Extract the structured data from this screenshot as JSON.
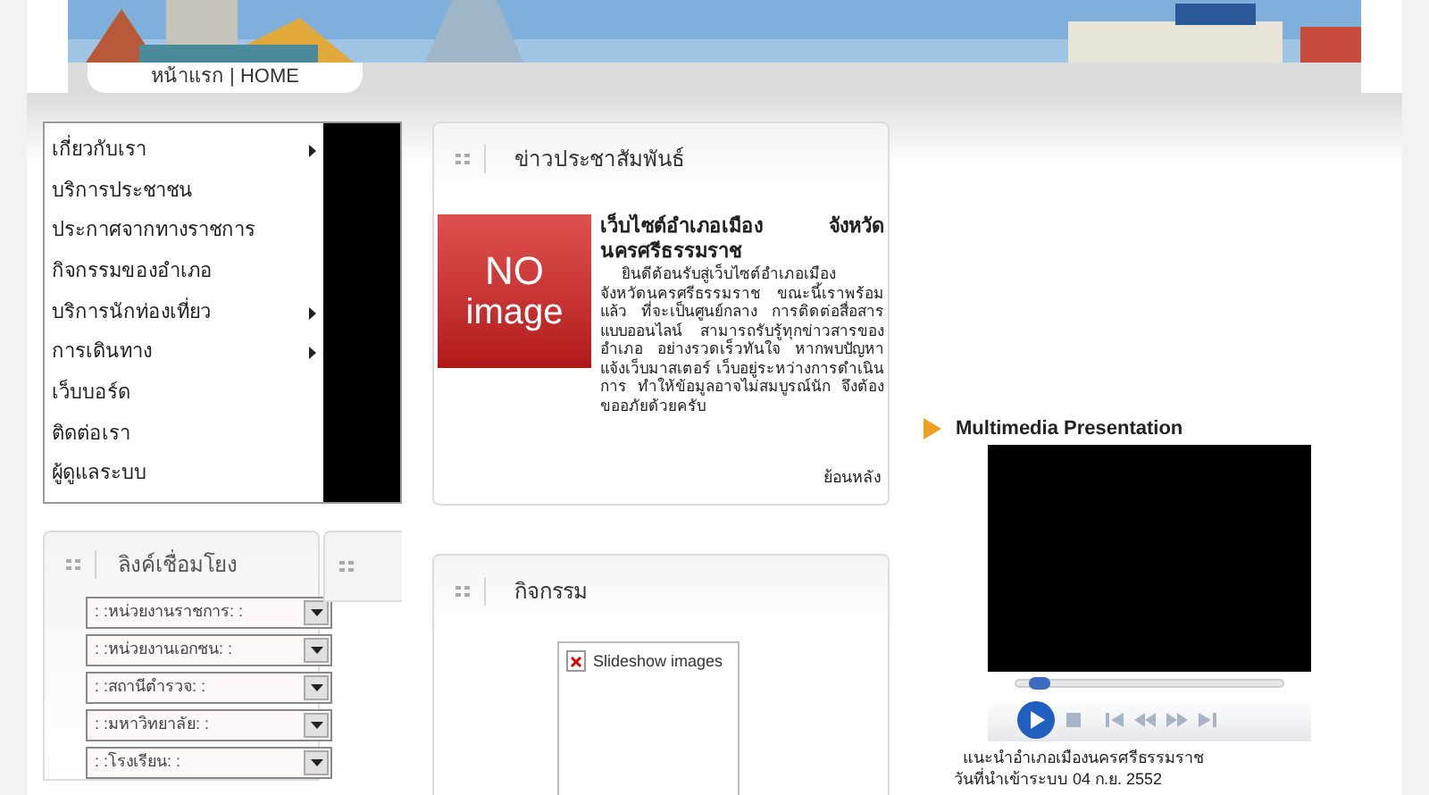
{
  "nav": {
    "label": "หน้าแรก | HOME"
  },
  "menu": [
    {
      "label": "เกี่ยวกับเรา",
      "submenu": true
    },
    {
      "label": "บริการประชาชน",
      "submenu": false
    },
    {
      "label": "ประกาศจากทางราชการ",
      "submenu": false
    },
    {
      "label": "กิจกรรมของอำเภอ",
      "submenu": false
    },
    {
      "label": "บริการนักท่องเที่ยว",
      "submenu": true
    },
    {
      "label": "การเดินทาง",
      "submenu": true
    },
    {
      "label": "เว็บบอร์ด",
      "submenu": false
    },
    {
      "label": "ติดต่อเรา",
      "submenu": false
    },
    {
      "label": "ผู้ดูแลระบบ",
      "submenu": false
    }
  ],
  "links": {
    "title": "ลิงค์เชื่อมโยง",
    "selects": [
      ": :หน่วยงานราชการ: :",
      ": :หน่วยงานเอกชน: :",
      ": :สถานีตำรวจ: :",
      ": :มหาวิทยาลัย: :",
      ": :โรงเรียน: :"
    ]
  },
  "news": {
    "title": "ข่าวประชาสัมพันธ์",
    "image_text": [
      "NO",
      "image"
    ],
    "headline": "เว็บไซต์อำเภอเมือง จังหวัดนครศรีธรรมราช",
    "body": "ยินดีต้อนรับสู่เว็บไซต์อำเภอเมือง จังหวัดนครศรีธรรมราช ขณะนี้เราพร้อมแล้ว ที่จะเป็นศูนย์กลาง การติดต่อสื่อสารแบบออนไลน์ สามารถรับรู้ทุกข่าวสารของอำเภอ อย่างรวดเร็วทันใจ หากพบปัญหาแจ้งเว็บมาสเตอร์ เว็บอยู่ระหว่างการดำเนินการ ทำให้ข้อมูลอาจไม่สมบูรณ์นัก จึงต้องขออภัยด้วยครับ",
    "more": "ย้อนหลัง"
  },
  "activity": {
    "title": "กิจกรรม",
    "slideshow": "Slideshow images"
  },
  "multimedia": {
    "title": "Multimedia Presentation",
    "level": 0.05,
    "caption": "แนะนำอำเภอเมืองนครศรีธรรมราช",
    "date": "วันที่นำเข้าระบบ 04 ก.ย. 2552"
  }
}
